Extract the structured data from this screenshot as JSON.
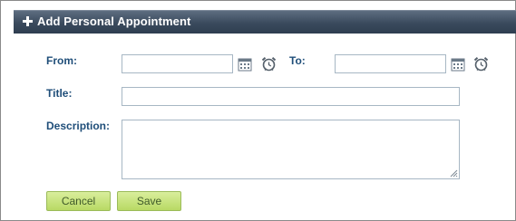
{
  "header": {
    "title": "Add Personal Appointment",
    "icon": "plus-icon"
  },
  "form": {
    "from_label": "From:",
    "from_value": "",
    "to_label": "To:",
    "to_value": "",
    "title_label": "Title:",
    "title_value": "",
    "description_label": "Description:",
    "description_value": ""
  },
  "buttons": {
    "cancel_label": "Cancel",
    "save_label": "Save"
  },
  "colors": {
    "header_bg": "#3a4a5d",
    "label_text": "#1f4e79",
    "button_bg": "#c5e07a",
    "input_border": "#a7b7c4"
  },
  "icons": [
    "plus-icon",
    "calendar-icon",
    "alarm-clock-icon",
    "resize-grip-icon"
  ]
}
